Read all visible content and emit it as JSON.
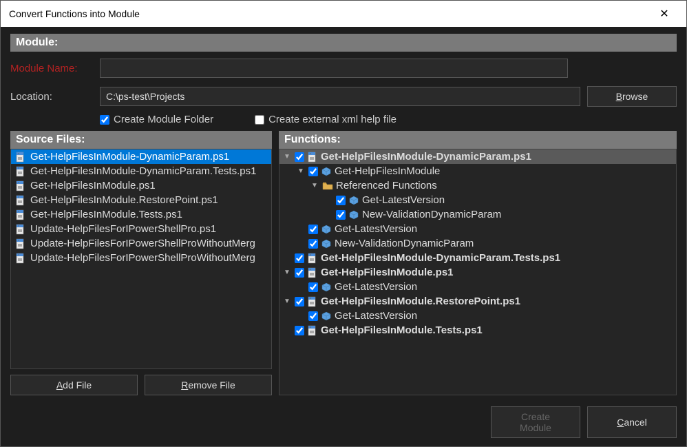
{
  "window": {
    "title": "Convert Functions into Module"
  },
  "module": {
    "header": "Module:",
    "name_label": "Module Name:",
    "name_value": "",
    "location_label": "Location:",
    "location_value": "C:\\ps-test\\Projects",
    "browse_label": "Browse",
    "create_folder_label": "Create Module Folder",
    "create_folder_checked": true,
    "create_xml_label": "Create external xml help file",
    "create_xml_checked": false
  },
  "source": {
    "header": "Source Files:",
    "files": [
      {
        "name": "Get-HelpFilesInModule-DynamicParam.ps1",
        "selected": true
      },
      {
        "name": "Get-HelpFilesInModule-DynamicParam.Tests.ps1",
        "selected": false
      },
      {
        "name": "Get-HelpFilesInModule.ps1",
        "selected": false
      },
      {
        "name": "Get-HelpFilesInModule.RestorePoint.ps1",
        "selected": false
      },
      {
        "name": "Get-HelpFilesInModule.Tests.ps1",
        "selected": false
      },
      {
        "name": "Update-HelpFilesForIPowerShellPro.ps1",
        "selected": false
      },
      {
        "name": "Update-HelpFilesForIPowerShellProWithoutMerg",
        "selected": false
      },
      {
        "name": "Update-HelpFilesForIPowerShellProWithoutMerg",
        "selected": false
      }
    ],
    "add_label": "Add File",
    "remove_label": "Remove File"
  },
  "functions": {
    "header": "Functions:",
    "tree": [
      {
        "indent": 0,
        "expanded": true,
        "checked": true,
        "icon": "file",
        "label": "Get-HelpFilesInModule-DynamicParam.ps1",
        "bold": true,
        "selected": true
      },
      {
        "indent": 1,
        "expanded": true,
        "checked": true,
        "icon": "cube",
        "label": "Get-HelpFilesInModule"
      },
      {
        "indent": 2,
        "expanded": true,
        "checked": null,
        "icon": "folder",
        "label": "Referenced Functions"
      },
      {
        "indent": 3,
        "expanded": null,
        "checked": true,
        "icon": "cube",
        "label": "Get-LatestVersion"
      },
      {
        "indent": 3,
        "expanded": null,
        "checked": true,
        "icon": "cube",
        "label": "New-ValidationDynamicParam"
      },
      {
        "indent": 1,
        "expanded": null,
        "checked": true,
        "icon": "cube",
        "label": "Get-LatestVersion"
      },
      {
        "indent": 1,
        "expanded": null,
        "checked": true,
        "icon": "cube",
        "label": "New-ValidationDynamicParam"
      },
      {
        "indent": 0,
        "expanded": null,
        "checked": true,
        "icon": "file",
        "label": "Get-HelpFilesInModule-DynamicParam.Tests.ps1",
        "bold": true
      },
      {
        "indent": 0,
        "expanded": true,
        "checked": true,
        "icon": "file",
        "label": "Get-HelpFilesInModule.ps1",
        "bold": true
      },
      {
        "indent": 1,
        "expanded": null,
        "checked": true,
        "icon": "cube",
        "label": "Get-LatestVersion"
      },
      {
        "indent": 0,
        "expanded": true,
        "checked": true,
        "icon": "file",
        "label": "Get-HelpFilesInModule.RestorePoint.ps1",
        "bold": true
      },
      {
        "indent": 1,
        "expanded": null,
        "checked": true,
        "icon": "cube",
        "label": "Get-LatestVersion"
      },
      {
        "indent": 0,
        "expanded": null,
        "checked": true,
        "icon": "file",
        "label": "Get-HelpFilesInModule.Tests.ps1",
        "bold": true
      }
    ]
  },
  "footer": {
    "create_label": "Create Module",
    "cancel_label": "Cancel"
  }
}
